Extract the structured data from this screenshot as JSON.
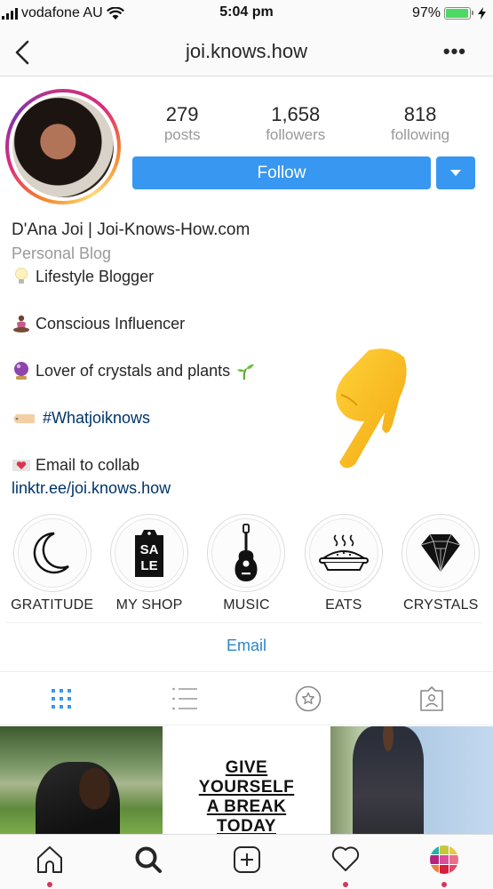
{
  "status_bar": {
    "carrier": "vodafone AU",
    "time": "5:04 pm",
    "battery_percent_label": "97%",
    "battery_level": 0.97
  },
  "nav": {
    "title": "joi.knows.how",
    "more_label": "•••"
  },
  "profile": {
    "stats": [
      {
        "value": "279",
        "label": "posts"
      },
      {
        "value": "1,658",
        "label": "followers"
      },
      {
        "value": "818",
        "label": "following"
      }
    ],
    "follow_label": "Follow",
    "name": "D'Ana Joi | Joi-Knows-How.com",
    "category": "Personal Blog",
    "bio_lines": [
      {
        "emoji": "light-bulb",
        "text": "Lifestyle Blogger"
      },
      {
        "emoji": "person-lotus",
        "text": "Conscious Influencer"
      },
      {
        "emoji": "crystal-ball",
        "text": "Lover of crystals and plants",
        "trailing_emoji": "seedling"
      },
      {
        "emoji": "label-tag",
        "text": "#Whatjoiknows"
      },
      {
        "emoji": "love-letter",
        "text": "Email to collab"
      }
    ],
    "link": "linktr.ee/joi.knows.how",
    "colors": {
      "accent": "#3897f0",
      "link": "#003569",
      "muted": "#999999"
    }
  },
  "highlights": [
    {
      "label": "GRATITUDE",
      "icon": "moon"
    },
    {
      "label": "MY SHOP",
      "icon": "sale-tag"
    },
    {
      "label": "MUSIC",
      "icon": "guitar"
    },
    {
      "label": "EATS",
      "icon": "pie"
    },
    {
      "label": "CRYSTALS",
      "icon": "diamond"
    }
  ],
  "email_button_label": "Email",
  "tabs": [
    {
      "name": "grid",
      "active": true
    },
    {
      "name": "list",
      "active": false
    },
    {
      "name": "saved-star",
      "active": false
    },
    {
      "name": "tagged",
      "active": false
    }
  ],
  "posts": [
    {
      "type": "photo",
      "description": "woman on tire swing in park"
    },
    {
      "type": "quote",
      "lines": [
        "GIVE",
        "YOURSELF",
        "A BREAK",
        "TODAY"
      ]
    },
    {
      "type": "photo",
      "description": "woman in floral dress against sky"
    }
  ],
  "bottom_nav": [
    {
      "name": "home",
      "notification": true
    },
    {
      "name": "search",
      "notification": false
    },
    {
      "name": "new-post",
      "notification": false
    },
    {
      "name": "activity",
      "notification": true
    },
    {
      "name": "profile",
      "notification": true
    }
  ]
}
